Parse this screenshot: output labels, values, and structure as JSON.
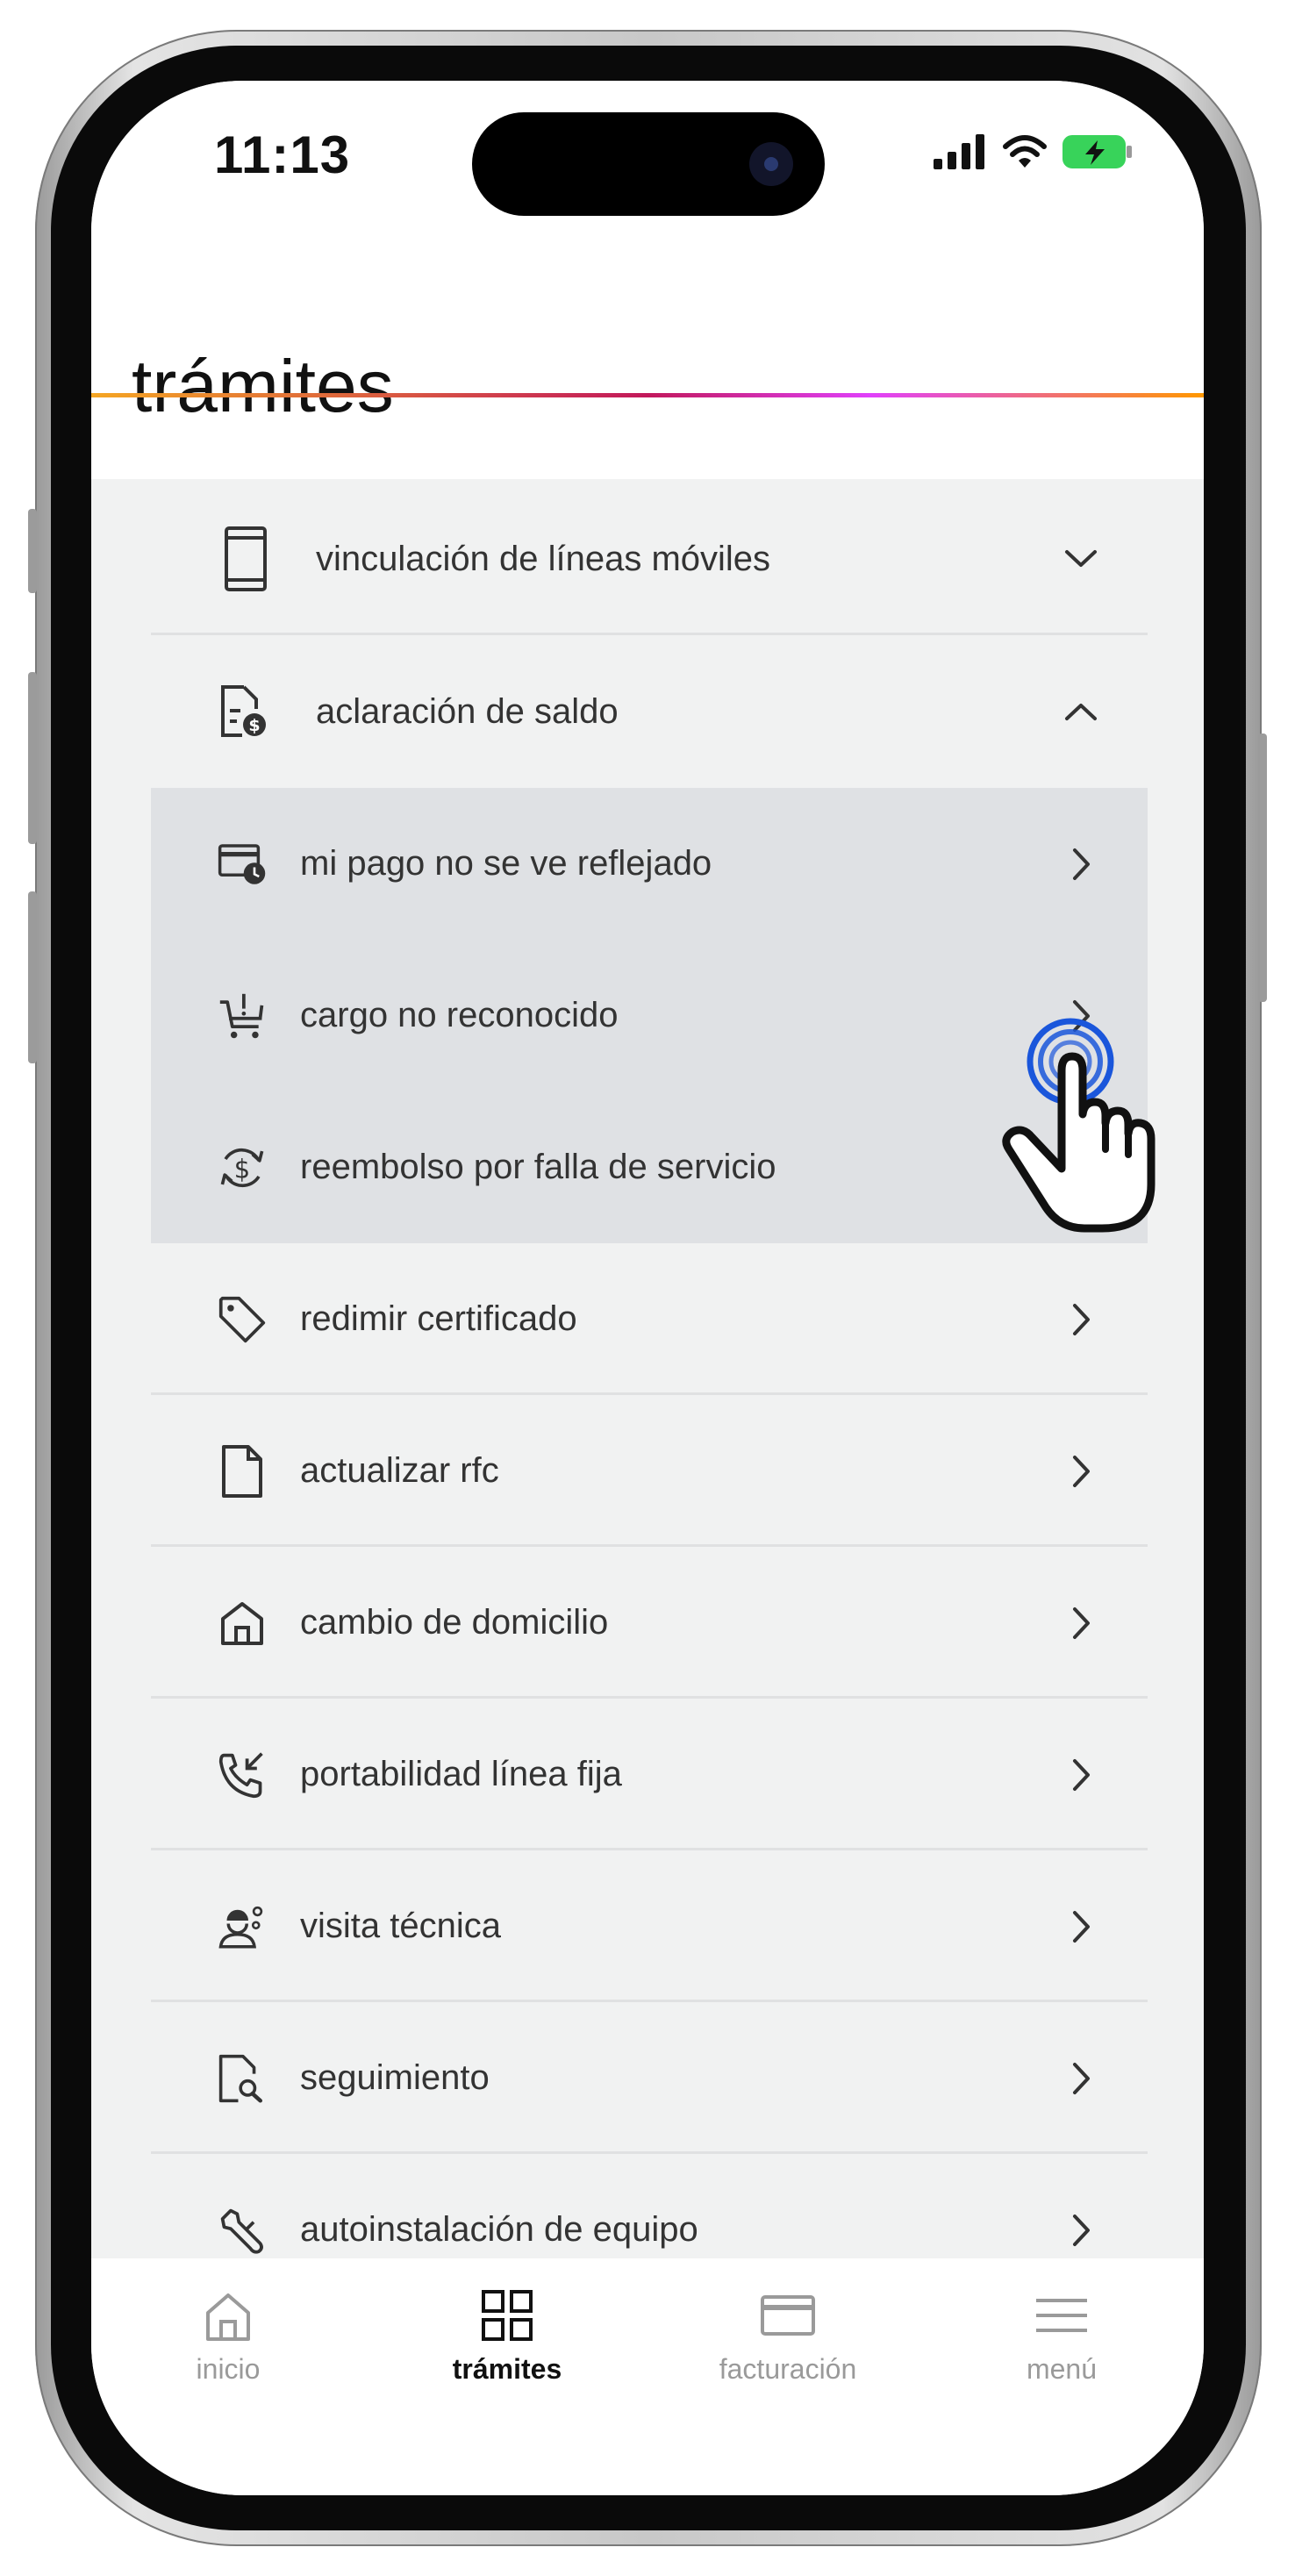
{
  "status_bar": {
    "time": "11:13"
  },
  "header": {
    "title": "trámites"
  },
  "sections": [
    {
      "label": "vinculación de líneas móviles",
      "icon": "smartphone-icon",
      "expanded": false
    },
    {
      "label": "aclaración de saldo",
      "icon": "document-dollar-icon",
      "expanded": true,
      "children": [
        {
          "label": "mi pago no se ve reflejado",
          "icon": "card-clock-icon"
        },
        {
          "label": "cargo no reconocido",
          "icon": "cart-alert-icon"
        },
        {
          "label": "reembolso por falla de servicio",
          "icon": "refund-icon"
        }
      ]
    }
  ],
  "items": [
    {
      "label": "redimir certificado",
      "icon": "tag-icon"
    },
    {
      "label": "actualizar rfc",
      "icon": "file-icon"
    },
    {
      "label": "cambio de domicilio",
      "icon": "home-icon"
    },
    {
      "label": "portabilidad línea fija",
      "icon": "phone-incoming-icon"
    },
    {
      "label": "visita técnica",
      "icon": "technician-icon"
    },
    {
      "label": "seguimiento",
      "icon": "document-search-icon"
    },
    {
      "label": "autoinstalación de equipo",
      "icon": "wrench-icon"
    }
  ],
  "tabbar": {
    "tabs": [
      {
        "label": "inicio",
        "icon": "home-icon",
        "active": false
      },
      {
        "label": "trámites",
        "icon": "grid-icon",
        "active": true
      },
      {
        "label": "facturación",
        "icon": "card-icon",
        "active": false
      },
      {
        "label": "menú",
        "icon": "hamburger-icon",
        "active": false
      }
    ]
  },
  "colors": {
    "gradient_start": "#f5a623",
    "gradient_mid": "#c2185b",
    "gradient_end": "#ff9800",
    "tap_indicator": "#1a56db"
  }
}
